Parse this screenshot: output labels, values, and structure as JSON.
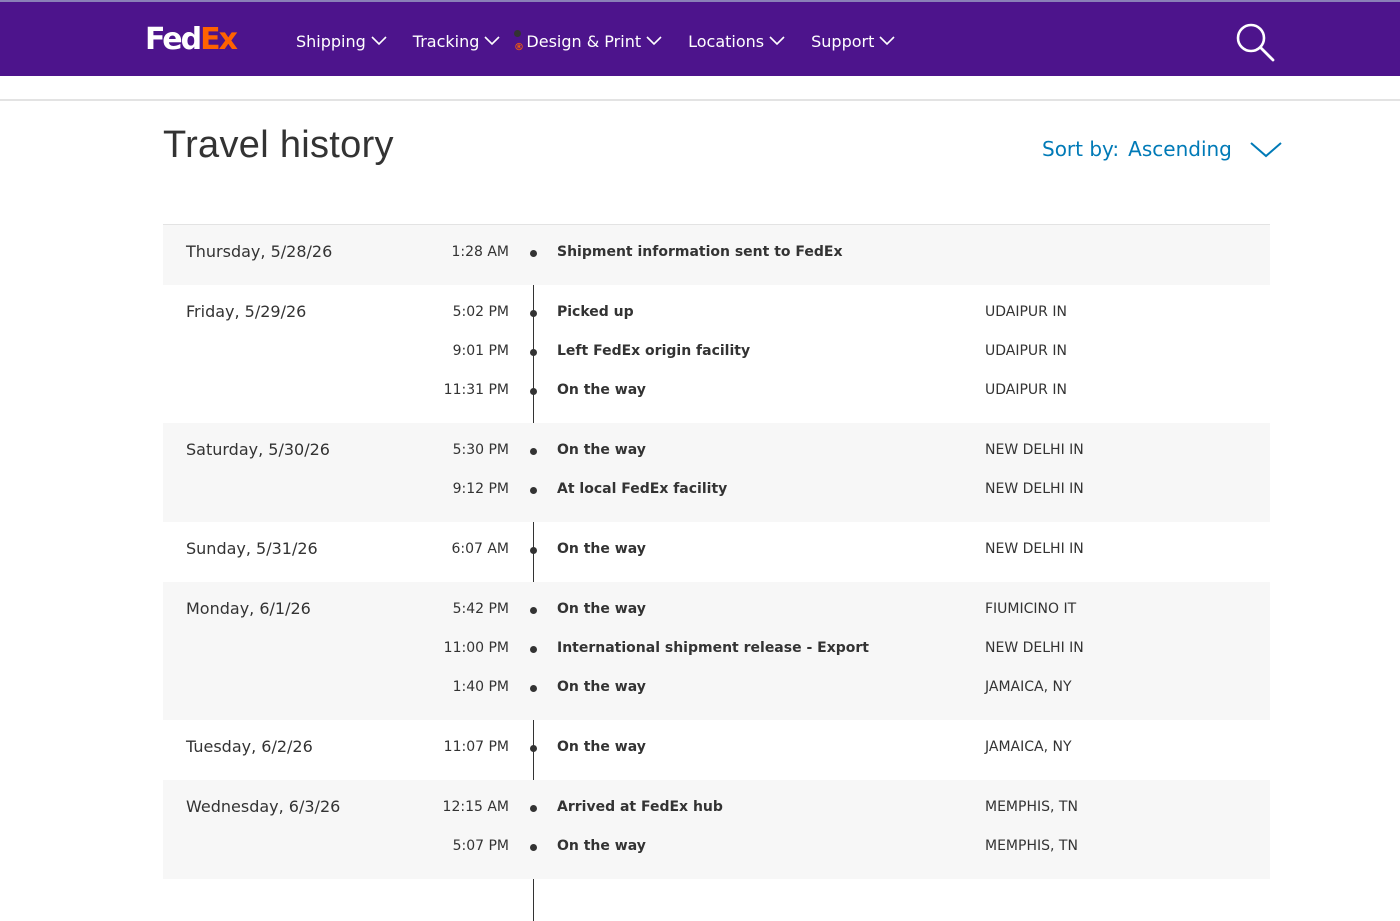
{
  "header": {
    "logo_fed": "Fed",
    "logo_ex": "Ex",
    "logo_dot": "®",
    "nav": [
      {
        "label": "Shipping"
      },
      {
        "label": "Tracking"
      },
      {
        "label": "Design & Print"
      },
      {
        "label": "Locations"
      },
      {
        "label": "Support"
      }
    ],
    "search_icon": "search-icon",
    "colors": {
      "brand_purple": "#4d148c",
      "brand_orange": "#ff6200",
      "link_blue": "#007ab7"
    }
  },
  "main": {
    "title": "Travel history",
    "sort": {
      "label": "Sort by:",
      "value": "Ascending"
    }
  },
  "history": [
    {
      "date": "Thursday, 5/28/26",
      "shaded": true,
      "events": [
        {
          "time": "1:28 AM",
          "status": "Shipment information sent to FedEx",
          "location": ""
        }
      ]
    },
    {
      "date": "Friday, 5/29/26",
      "shaded": false,
      "events": [
        {
          "time": "5:02 PM",
          "status": "Picked up",
          "location": "UDAIPUR IN"
        },
        {
          "time": "9:01 PM",
          "status": "Left FedEx origin facility",
          "location": "UDAIPUR IN"
        },
        {
          "time": "11:31 PM",
          "status": "On the way",
          "location": "UDAIPUR IN"
        }
      ]
    },
    {
      "date": "Saturday, 5/30/26",
      "shaded": true,
      "events": [
        {
          "time": "5:30 PM",
          "status": "On the way",
          "location": "NEW DELHI IN"
        },
        {
          "time": "9:12 PM",
          "status": "At local FedEx facility",
          "location": "NEW DELHI IN"
        }
      ]
    },
    {
      "date": "Sunday, 5/31/26",
      "shaded": false,
      "events": [
        {
          "time": "6:07 AM",
          "status": "On the way",
          "location": "NEW DELHI IN"
        }
      ]
    },
    {
      "date": "Monday, 6/1/26",
      "shaded": true,
      "events": [
        {
          "time": "5:42 PM",
          "status": "On the way",
          "location": "FIUMICINO IT"
        },
        {
          "time": "11:00 PM",
          "status": "International shipment release - Export",
          "location": "NEW DELHI IN"
        },
        {
          "time": "1:40 PM",
          "status": "On the way",
          "location": "JAMAICA, NY"
        }
      ]
    },
    {
      "date": "Tuesday, 6/2/26",
      "shaded": false,
      "events": [
        {
          "time": "11:07 PM",
          "status": "On the way",
          "location": "JAMAICA, NY"
        }
      ]
    },
    {
      "date": "Wednesday, 6/3/26",
      "shaded": true,
      "events": [
        {
          "time": "12:15 AM",
          "status": "Arrived at FedEx hub",
          "location": "MEMPHIS, TN"
        },
        {
          "time": "5:07 PM",
          "status": "On the way",
          "location": "MEMPHIS, TN"
        }
      ]
    }
  ]
}
